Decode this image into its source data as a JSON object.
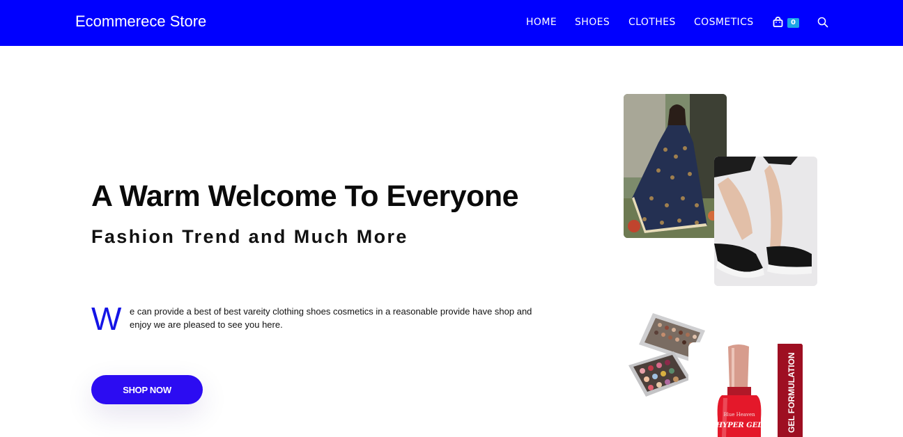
{
  "header": {
    "brand": "Ecommerece Store",
    "nav": [
      "HOME",
      "SHOES",
      "CLOTHES",
      "COSMETICS"
    ],
    "cart_count": "0",
    "cart_icon": "shopping-bag-icon",
    "search_icon": "search-icon",
    "background_color": "#0000ff"
  },
  "hero": {
    "title": "A Warm Welcome To Everyone",
    "subtitle": "Fashion Trend and Much More",
    "dropcap": "W",
    "intro": "e can provide a best of best vareity clothing shoes cosmetics in a reasonable provide have shop and enjoy we are pleased to see you here.",
    "button": "SHOP NOW",
    "button_color": "#2c0cf2",
    "dropcap_color": "#1414e6"
  },
  "gallery": {
    "polish_brand": "Blue Heaven",
    "polish_name": "HYPER GEL",
    "box_label": "GEL FORMULATION"
  }
}
